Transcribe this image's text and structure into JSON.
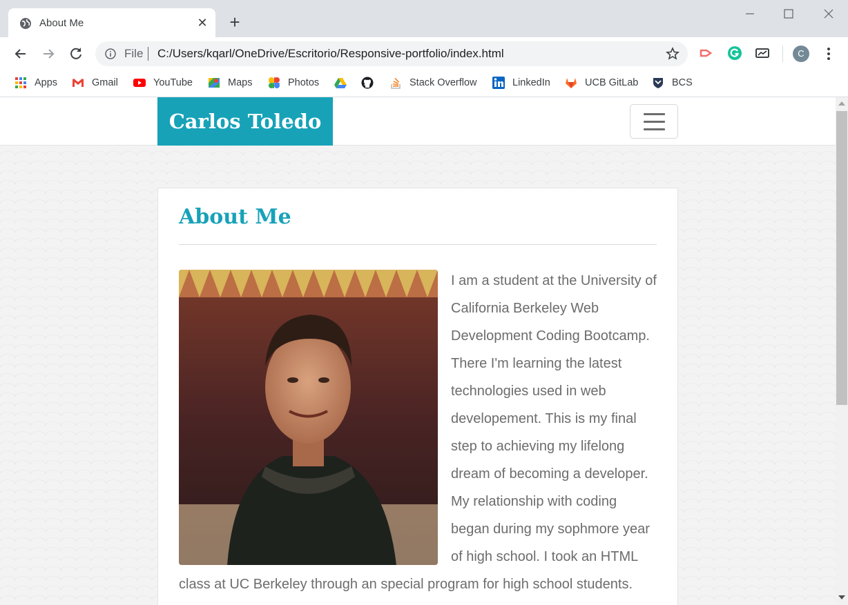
{
  "browser": {
    "tab": {
      "title": "About Me",
      "close_glyph": "✕",
      "favicon": "globe-icon"
    },
    "new_tab_glyph": "+",
    "address_bar": {
      "scheme_label": "File",
      "url": "C:/Users/kqarl/OneDrive/Escritorio/Responsive-portfolio/index.html"
    },
    "profile_initial": "C",
    "bookmarks": [
      {
        "label": "Apps",
        "icon": "apps-grid-icon"
      },
      {
        "label": "Gmail",
        "icon": "gmail-icon"
      },
      {
        "label": "YouTube",
        "icon": "youtube-icon"
      },
      {
        "label": "Maps",
        "icon": "maps-icon"
      },
      {
        "label": "Photos",
        "icon": "photos-icon"
      },
      {
        "label": "",
        "icon": "google-drive-icon"
      },
      {
        "label": "",
        "icon": "github-icon"
      },
      {
        "label": "Stack Overflow",
        "icon": "stack-overflow-icon"
      },
      {
        "label": "LinkedIn",
        "icon": "linkedin-icon"
      },
      {
        "label": "UCB GitLab",
        "icon": "gitlab-icon"
      },
      {
        "label": "BCS",
        "icon": "bcs-shield-icon"
      }
    ]
  },
  "site": {
    "brand": "Carlos Toledo",
    "section_title": "About Me",
    "photo_alt": "Portrait photo",
    "bio": "I am a student at the University of California Berkeley Web Development Coding Bootcamp. There I'm learning the latest technologies used in web developement. This is my final step to achieving my lifelong dream of becoming a developer. My relationship with coding began during my sophmore year of high school. I took an HTML class at UC Berkeley through an special program for high school students."
  },
  "colors": {
    "accent": "#17a2b8",
    "body_text": "#6c6c6c",
    "tabstrip": "#dee1e6"
  }
}
